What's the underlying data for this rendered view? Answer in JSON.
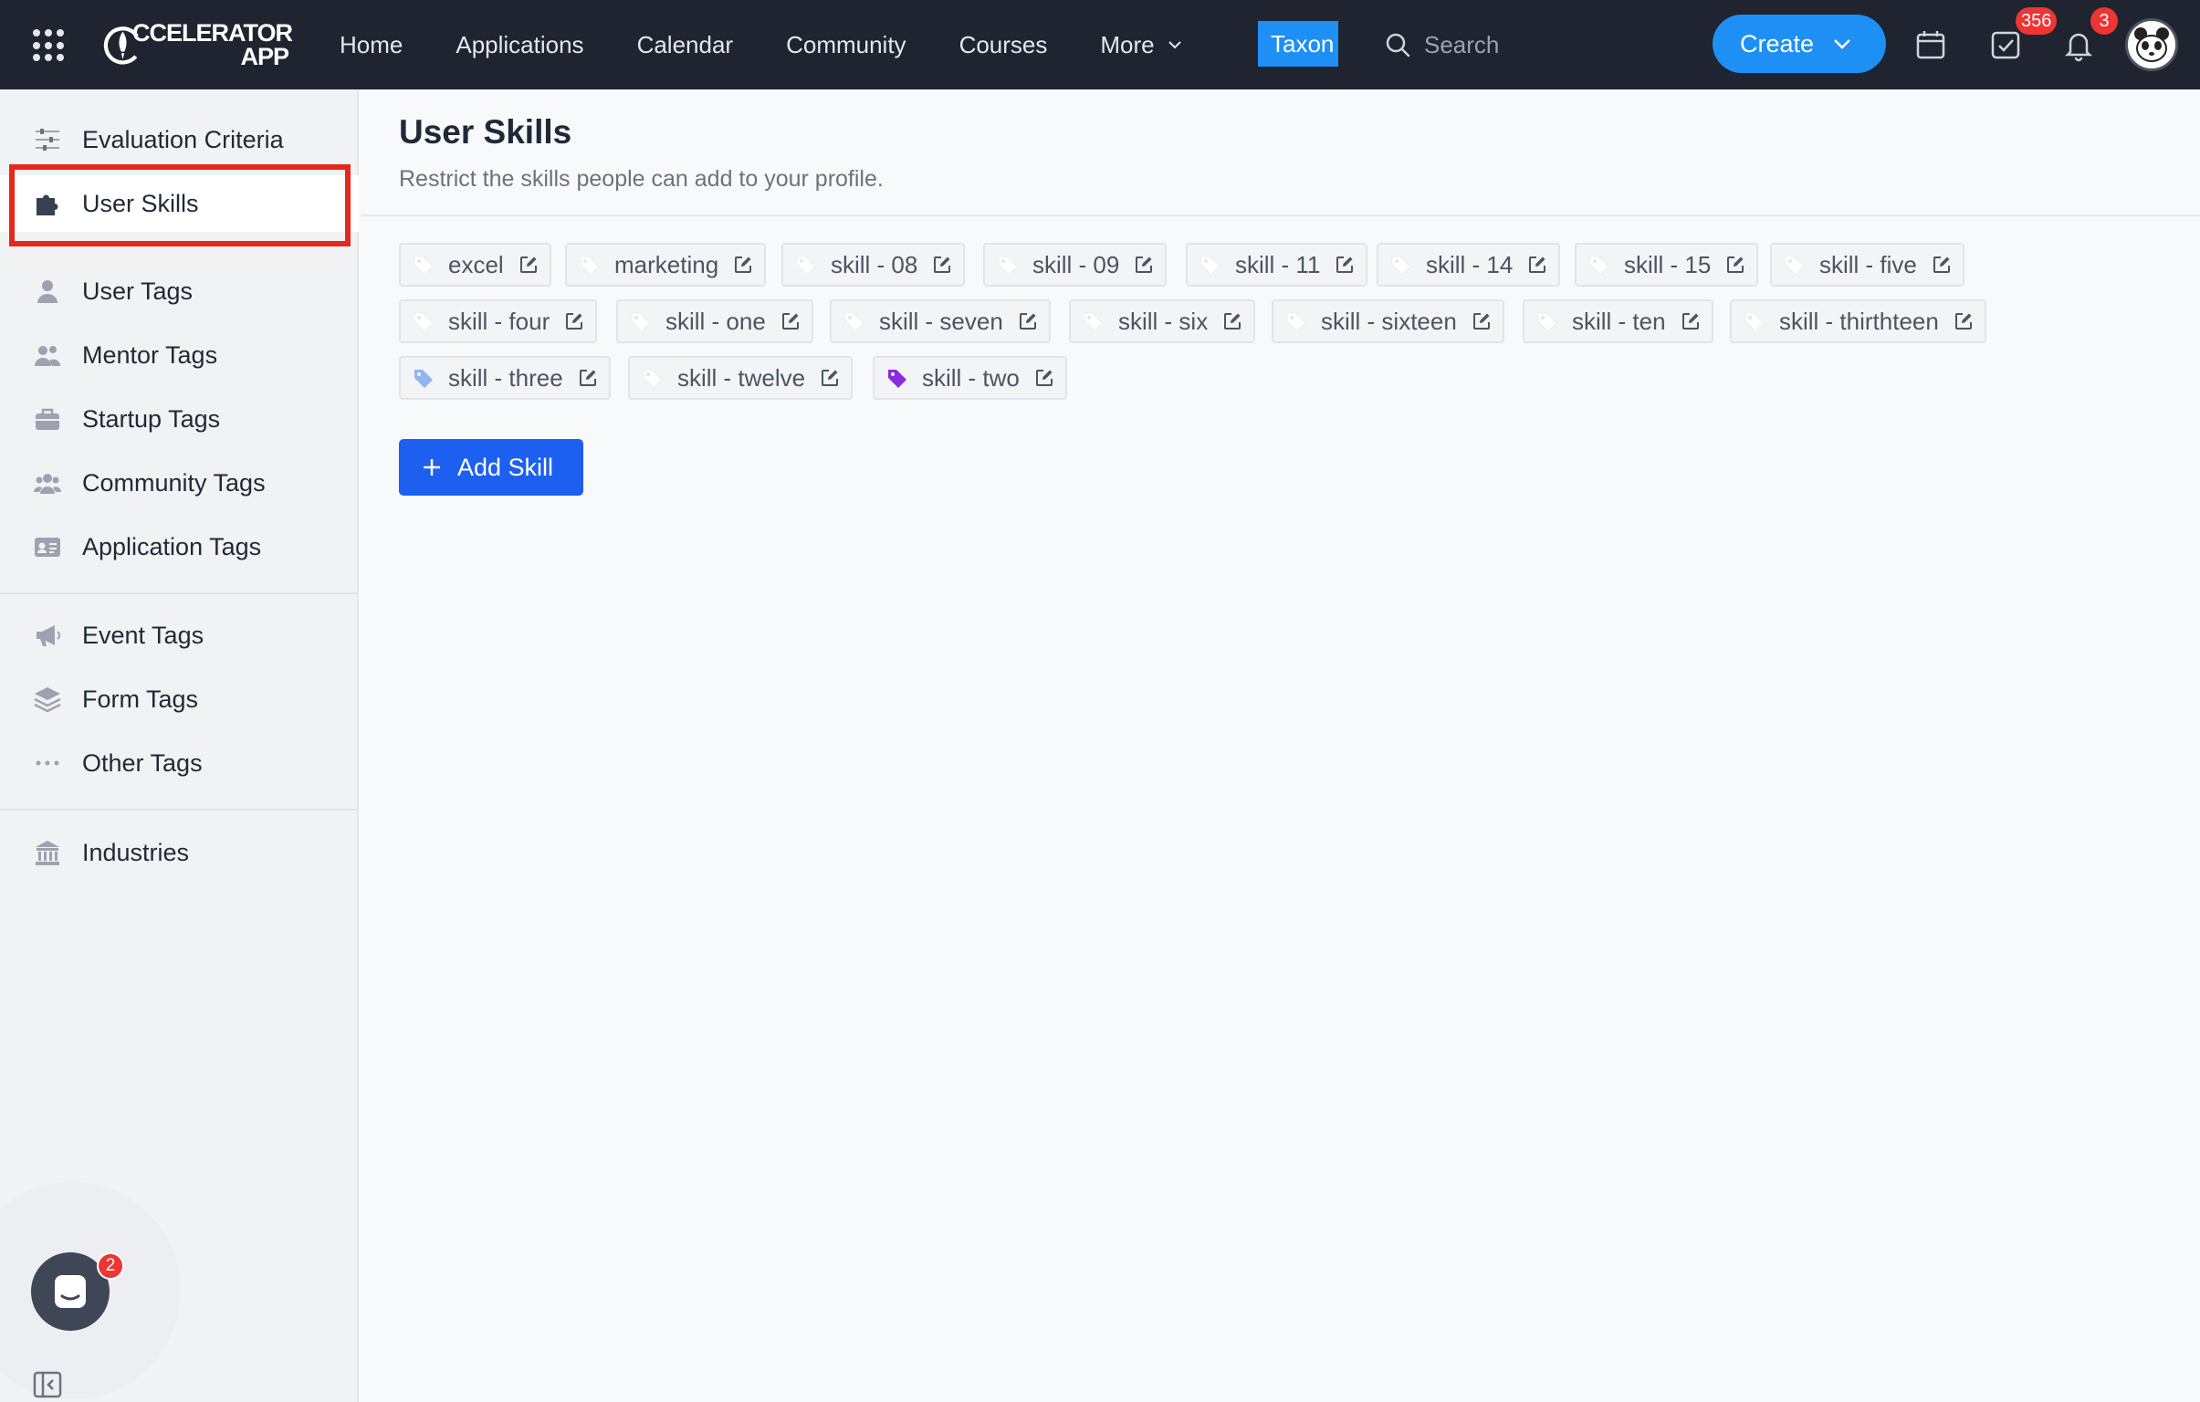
{
  "app": {
    "logo_line1": "CCELERATOR",
    "logo_line2": "APP"
  },
  "nav": {
    "items": [
      "Home",
      "Applications",
      "Calendar",
      "Community",
      "Courses",
      "More"
    ],
    "taxon_label": "Taxon",
    "search_placeholder": "Search",
    "create_label": "Create",
    "tasks_badge": "356",
    "notifications_badge": "3"
  },
  "sidebar": {
    "items": [
      {
        "label": "Evaluation Criteria",
        "icon": "sliders-icon"
      },
      {
        "label": "User Skills",
        "icon": "puzzle-icon",
        "active": true
      },
      {
        "label": "User Tags",
        "icon": "user-icon"
      },
      {
        "label": "Mentor Tags",
        "icon": "users-icon"
      },
      {
        "label": "Startup Tags",
        "icon": "briefcase-icon"
      },
      {
        "label": "Community Tags",
        "icon": "group-icon"
      },
      {
        "label": "Application Tags",
        "icon": "id-card-icon"
      },
      {
        "label": "Event Tags",
        "icon": "megaphone-icon"
      },
      {
        "label": "Form Tags",
        "icon": "layers-icon"
      },
      {
        "label": "Other Tags",
        "icon": "ellipsis-icon"
      },
      {
        "label": "Industries",
        "icon": "building-icon"
      }
    ],
    "chat_badge": "2"
  },
  "main": {
    "title": "User Skills",
    "subtitle": "Restrict the skills people can add to your profile.",
    "add_label": "Add Skill",
    "skills": [
      {
        "label": "excel",
        "color": "#ffffff"
      },
      {
        "label": "marketing",
        "color": "#ffffff"
      },
      {
        "label": "skill - 08",
        "color": "#ffffff"
      },
      {
        "label": "skill - 09",
        "color": "#ffffff"
      },
      {
        "label": "skill - 11",
        "color": "#ffffff"
      },
      {
        "label": "skill - 14",
        "color": "#ffffff"
      },
      {
        "label": "skill - 15",
        "color": "#ffffff"
      },
      {
        "label": "skill - five",
        "color": "#ffffff"
      },
      {
        "label": "skill - four",
        "color": "#ffffff"
      },
      {
        "label": "skill - one",
        "color": "#ffffff"
      },
      {
        "label": "skill - seven",
        "color": "#ffffff"
      },
      {
        "label": "skill - six",
        "color": "#ffffff"
      },
      {
        "label": "skill - sixteen",
        "color": "#ffffff"
      },
      {
        "label": "skill - ten",
        "color": "#ffffff"
      },
      {
        "label": "skill - thirthteen",
        "color": "#ffffff"
      },
      {
        "label": "skill - three",
        "color": "#8fb6f0"
      },
      {
        "label": "skill - twelve",
        "color": "#ffffff"
      },
      {
        "label": "skill - two",
        "color": "#8a2be2"
      }
    ]
  },
  "colors": {
    "topbar": "#1f2430",
    "accent": "#1e8ff5",
    "primary_button": "#1d5ff0",
    "highlight": "#e8271b",
    "badge": "#ef3434"
  }
}
